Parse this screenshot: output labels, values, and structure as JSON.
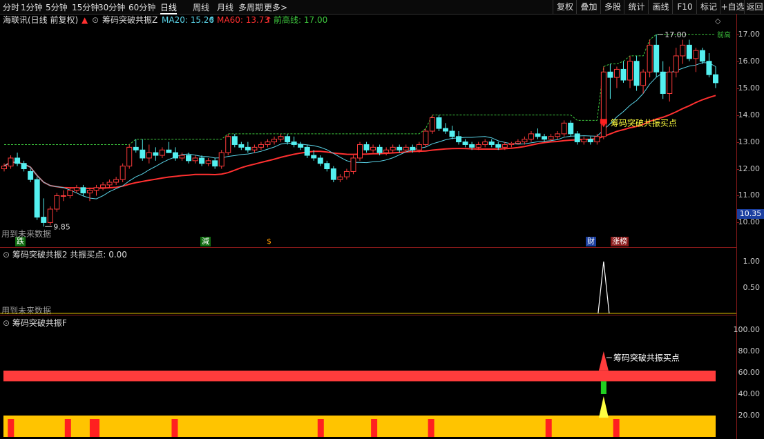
{
  "toolbar": {
    "periods": [
      "分时",
      "1分钟",
      "5分钟",
      "15分钟",
      "30分钟",
      "60分钟",
      "日线",
      "周线",
      "月线",
      "多周期",
      "更多>"
    ],
    "active": "日线",
    "right": [
      "复权",
      "叠加",
      "多股",
      "统计",
      "画线",
      "F10",
      "标记",
      "+自选",
      "返回"
    ]
  },
  "info": {
    "stock": "海联讯(日线 前复权)",
    "indicator": "筹码突破共振Z",
    "ma20_label": "MA20: 15.26",
    "ma60_label": "MA60: 13.73",
    "qgx_label": "前高线: 17.00",
    "colors": {
      "ma20": "#5ad4e8",
      "ma60": "#ff3030",
      "qgx": "#3ec83e"
    }
  },
  "main": {
    "y_labels": [
      "17.00",
      "16.00",
      "15.00",
      "14.00",
      "13.00",
      "12.00",
      "11.00",
      "10.00"
    ],
    "current_price": "10.35",
    "high_label": "17.00",
    "low_label": "9.85",
    "future_text": "用到未来数据",
    "buy_label": "筹码突破共振买点",
    "peak_tag": "前高",
    "markers": {
      "die": "跌",
      "jian": "減",
      "dollar": "$",
      "cai": "财",
      "zhangbang": "涨榜"
    }
  },
  "pane2": {
    "title": "筹码突破共振2",
    "value": "共振买点: 0.00",
    "future_text": "用到未来数据",
    "y_labels": [
      "1.00",
      "0.50"
    ]
  },
  "pane3": {
    "title": "筹码突破共振F",
    "buy_label": "筹码突破共振买点",
    "y_labels": [
      "100.00",
      "80.00",
      "60.00",
      "40.00",
      "20.00"
    ]
  },
  "chart_data": {
    "type": "candlestick",
    "ylim": [
      9.6,
      17.2
    ],
    "candles": [
      [
        12.0,
        12.2,
        11.9,
        12.1
      ],
      [
        12.1,
        12.5,
        12.0,
        12.4
      ],
      [
        12.4,
        12.6,
        12.1,
        12.2
      ],
      [
        12.2,
        12.3,
        11.9,
        12.0
      ],
      [
        11.9,
        12.0,
        11.5,
        11.6
      ],
      [
        11.6,
        11.7,
        10.1,
        10.2
      ],
      [
        10.2,
        10.9,
        9.85,
        10.0
      ],
      [
        10.0,
        10.6,
        9.9,
        10.5
      ],
      [
        10.5,
        11.1,
        10.4,
        11.0
      ],
      [
        11.0,
        11.2,
        10.8,
        11.0
      ],
      [
        11.0,
        11.3,
        10.9,
        11.2
      ],
      [
        11.2,
        11.4,
        11.1,
        11.3
      ],
      [
        11.3,
        11.4,
        11.0,
        11.1
      ],
      [
        11.1,
        11.3,
        10.8,
        11.2
      ],
      [
        11.2,
        11.4,
        11.0,
        11.3
      ],
      [
        11.3,
        11.5,
        11.2,
        11.4
      ],
      [
        11.4,
        11.6,
        11.3,
        11.5
      ],
      [
        11.5,
        11.7,
        11.4,
        11.6
      ],
      [
        11.6,
        12.2,
        11.5,
        12.1
      ],
      [
        12.1,
        12.9,
        12.0,
        12.8
      ],
      [
        12.8,
        13.1,
        12.6,
        12.7
      ],
      [
        12.7,
        13.1,
        12.3,
        12.4
      ],
      [
        12.4,
        12.9,
        12.2,
        12.6
      ],
      [
        12.6,
        12.8,
        12.3,
        12.5
      ],
      [
        12.5,
        12.8,
        12.4,
        12.7
      ],
      [
        12.7,
        13.0,
        12.6,
        12.6
      ],
      [
        12.6,
        12.8,
        12.3,
        12.4
      ],
      [
        12.4,
        12.6,
        12.3,
        12.5
      ],
      [
        12.5,
        12.6,
        12.2,
        12.3
      ],
      [
        12.3,
        12.5,
        12.2,
        12.4
      ],
      [
        12.4,
        12.5,
        12.1,
        12.2
      ],
      [
        12.2,
        12.4,
        12.1,
        12.3
      ],
      [
        12.3,
        12.4,
        12.0,
        12.1
      ],
      [
        12.1,
        12.7,
        12.0,
        12.6
      ],
      [
        12.6,
        13.3,
        12.5,
        13.2
      ],
      [
        13.2,
        13.3,
        12.8,
        12.9
      ],
      [
        12.9,
        13.0,
        12.7,
        12.8
      ],
      [
        12.8,
        13.0,
        12.6,
        12.7
      ],
      [
        12.7,
        12.9,
        12.6,
        12.8
      ],
      [
        12.8,
        13.0,
        12.7,
        12.9
      ],
      [
        12.9,
        13.1,
        12.8,
        13.0
      ],
      [
        13.0,
        13.2,
        12.9,
        13.1
      ],
      [
        13.1,
        13.3,
        13.0,
        13.2
      ],
      [
        13.2,
        13.3,
        12.9,
        13.0
      ],
      [
        13.0,
        13.2,
        12.8,
        12.9
      ],
      [
        12.9,
        13.0,
        12.7,
        12.8
      ],
      [
        12.8,
        12.9,
        12.4,
        12.5
      ],
      [
        12.5,
        12.7,
        12.3,
        12.4
      ],
      [
        12.4,
        12.5,
        12.1,
        12.2
      ],
      [
        12.2,
        12.3,
        11.9,
        12.0
      ],
      [
        12.0,
        12.1,
        11.5,
        11.6
      ],
      [
        11.6,
        11.8,
        11.5,
        11.7
      ],
      [
        11.7,
        12.0,
        11.6,
        11.9
      ],
      [
        11.9,
        12.5,
        11.8,
        12.4
      ],
      [
        12.4,
        13.0,
        12.3,
        12.9
      ],
      [
        12.9,
        13.0,
        12.6,
        12.7
      ],
      [
        12.7,
        12.9,
        12.6,
        12.8
      ],
      [
        12.8,
        12.9,
        12.5,
        12.6
      ],
      [
        12.6,
        12.8,
        12.5,
        12.7
      ],
      [
        12.7,
        12.9,
        12.6,
        12.8
      ],
      [
        12.8,
        12.9,
        12.6,
        12.7
      ],
      [
        12.7,
        12.9,
        12.6,
        12.8
      ],
      [
        12.8,
        12.9,
        12.6,
        12.7
      ],
      [
        12.7,
        13.0,
        12.6,
        12.9
      ],
      [
        12.9,
        13.5,
        12.8,
        13.4
      ],
      [
        13.4,
        14.0,
        13.3,
        13.9
      ],
      [
        13.9,
        14.0,
        13.4,
        13.5
      ],
      [
        13.5,
        13.7,
        13.3,
        13.4
      ],
      [
        13.4,
        13.6,
        13.1,
        13.2
      ],
      [
        13.2,
        13.4,
        12.9,
        13.0
      ],
      [
        13.0,
        13.1,
        12.8,
        12.9
      ],
      [
        12.9,
        13.0,
        12.7,
        12.8
      ],
      [
        12.8,
        13.0,
        12.7,
        12.9
      ],
      [
        12.9,
        13.1,
        12.8,
        13.0
      ],
      [
        13.0,
        13.1,
        12.8,
        12.9
      ],
      [
        12.9,
        13.0,
        12.7,
        12.8
      ],
      [
        12.8,
        13.0,
        12.7,
        12.9
      ],
      [
        12.9,
        13.0,
        12.8,
        12.95
      ],
      [
        12.95,
        13.1,
        12.9,
        13.0
      ],
      [
        13.0,
        13.2,
        12.9,
        13.1
      ],
      [
        13.1,
        13.4,
        13.0,
        13.3
      ],
      [
        13.3,
        13.5,
        13.1,
        13.2
      ],
      [
        13.2,
        13.3,
        13.0,
        13.1
      ],
      [
        13.1,
        13.3,
        13.0,
        13.2
      ],
      [
        13.2,
        13.4,
        13.1,
        13.3
      ],
      [
        13.3,
        13.8,
        13.2,
        13.7
      ],
      [
        13.7,
        13.8,
        13.2,
        13.3
      ],
      [
        13.3,
        13.4,
        12.9,
        13.0
      ],
      [
        13.0,
        13.2,
        12.9,
        13.1
      ],
      [
        13.1,
        13.2,
        12.9,
        13.0
      ],
      [
        13.0,
        13.3,
        12.9,
        13.2
      ],
      [
        13.2,
        15.8,
        13.1,
        15.6
      ],
      [
        15.6,
        15.9,
        14.6,
        15.4
      ],
      [
        15.4,
        15.8,
        15.0,
        15.7
      ],
      [
        15.7,
        16.0,
        15.2,
        15.3
      ],
      [
        15.3,
        16.2,
        15.0,
        16.0
      ],
      [
        16.0,
        16.2,
        14.9,
        15.1
      ],
      [
        15.1,
        15.7,
        14.8,
        15.6
      ],
      [
        15.6,
        16.8,
        15.4,
        16.6
      ],
      [
        16.6,
        17.0,
        15.4,
        15.6
      ],
      [
        15.6,
        16.0,
        14.6,
        14.8
      ],
      [
        14.8,
        15.8,
        14.5,
        15.6
      ],
      [
        15.6,
        16.5,
        15.4,
        16.2
      ],
      [
        16.2,
        16.8,
        15.9,
        16.6
      ],
      [
        16.6,
        16.8,
        16.0,
        16.1
      ],
      [
        16.1,
        16.5,
        15.6,
        16.4
      ],
      [
        16.4,
        16.5,
        15.9,
        16.0
      ],
      [
        16.0,
        16.3,
        15.4,
        15.5
      ],
      [
        15.5,
        15.8,
        15.0,
        15.2
      ]
    ],
    "buy_signal_index": 91,
    "pane3_bar_positions": [
      0.01,
      0.09,
      0.125,
      0.13,
      0.24,
      0.445,
      0.52,
      0.6,
      0.765,
      0.86
    ],
    "pane3_levels": {
      "red_band": [
        52,
        62
      ],
      "yellow_band": [
        0,
        20
      ]
    }
  }
}
